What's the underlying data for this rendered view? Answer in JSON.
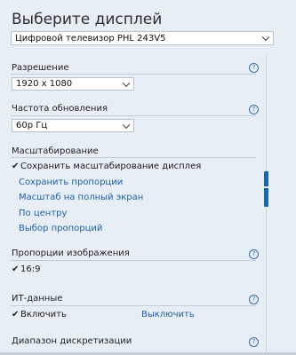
{
  "title": "Выберите дисплей",
  "display_select": {
    "value": "Цифровой телевизор PHL 243V5"
  },
  "resolution": {
    "label": "Разрешение",
    "value": "1920 x 1080"
  },
  "refresh": {
    "label": "Частота обновления",
    "value": "60р Гц"
  },
  "scaling": {
    "label": "Масштабирование",
    "selected": "Сохранить масштабирование дисплея",
    "options": [
      "Сохранить пропорции",
      "Масштаб на полный экран",
      "По центру",
      "Выбор пропорций"
    ]
  },
  "aspect": {
    "label": "Пропорции изображения",
    "selected": "16:9"
  },
  "it": {
    "label": "ИТ-данные",
    "on": "Включить",
    "off": "Выключить"
  },
  "range": {
    "label": "Диапазон дискретизации"
  },
  "icons": {
    "help": "?",
    "check": "✔"
  },
  "colors": {
    "accent": "#1f5fa8",
    "background": "#e7eef5",
    "scroll_thumb": "#1565c0"
  }
}
